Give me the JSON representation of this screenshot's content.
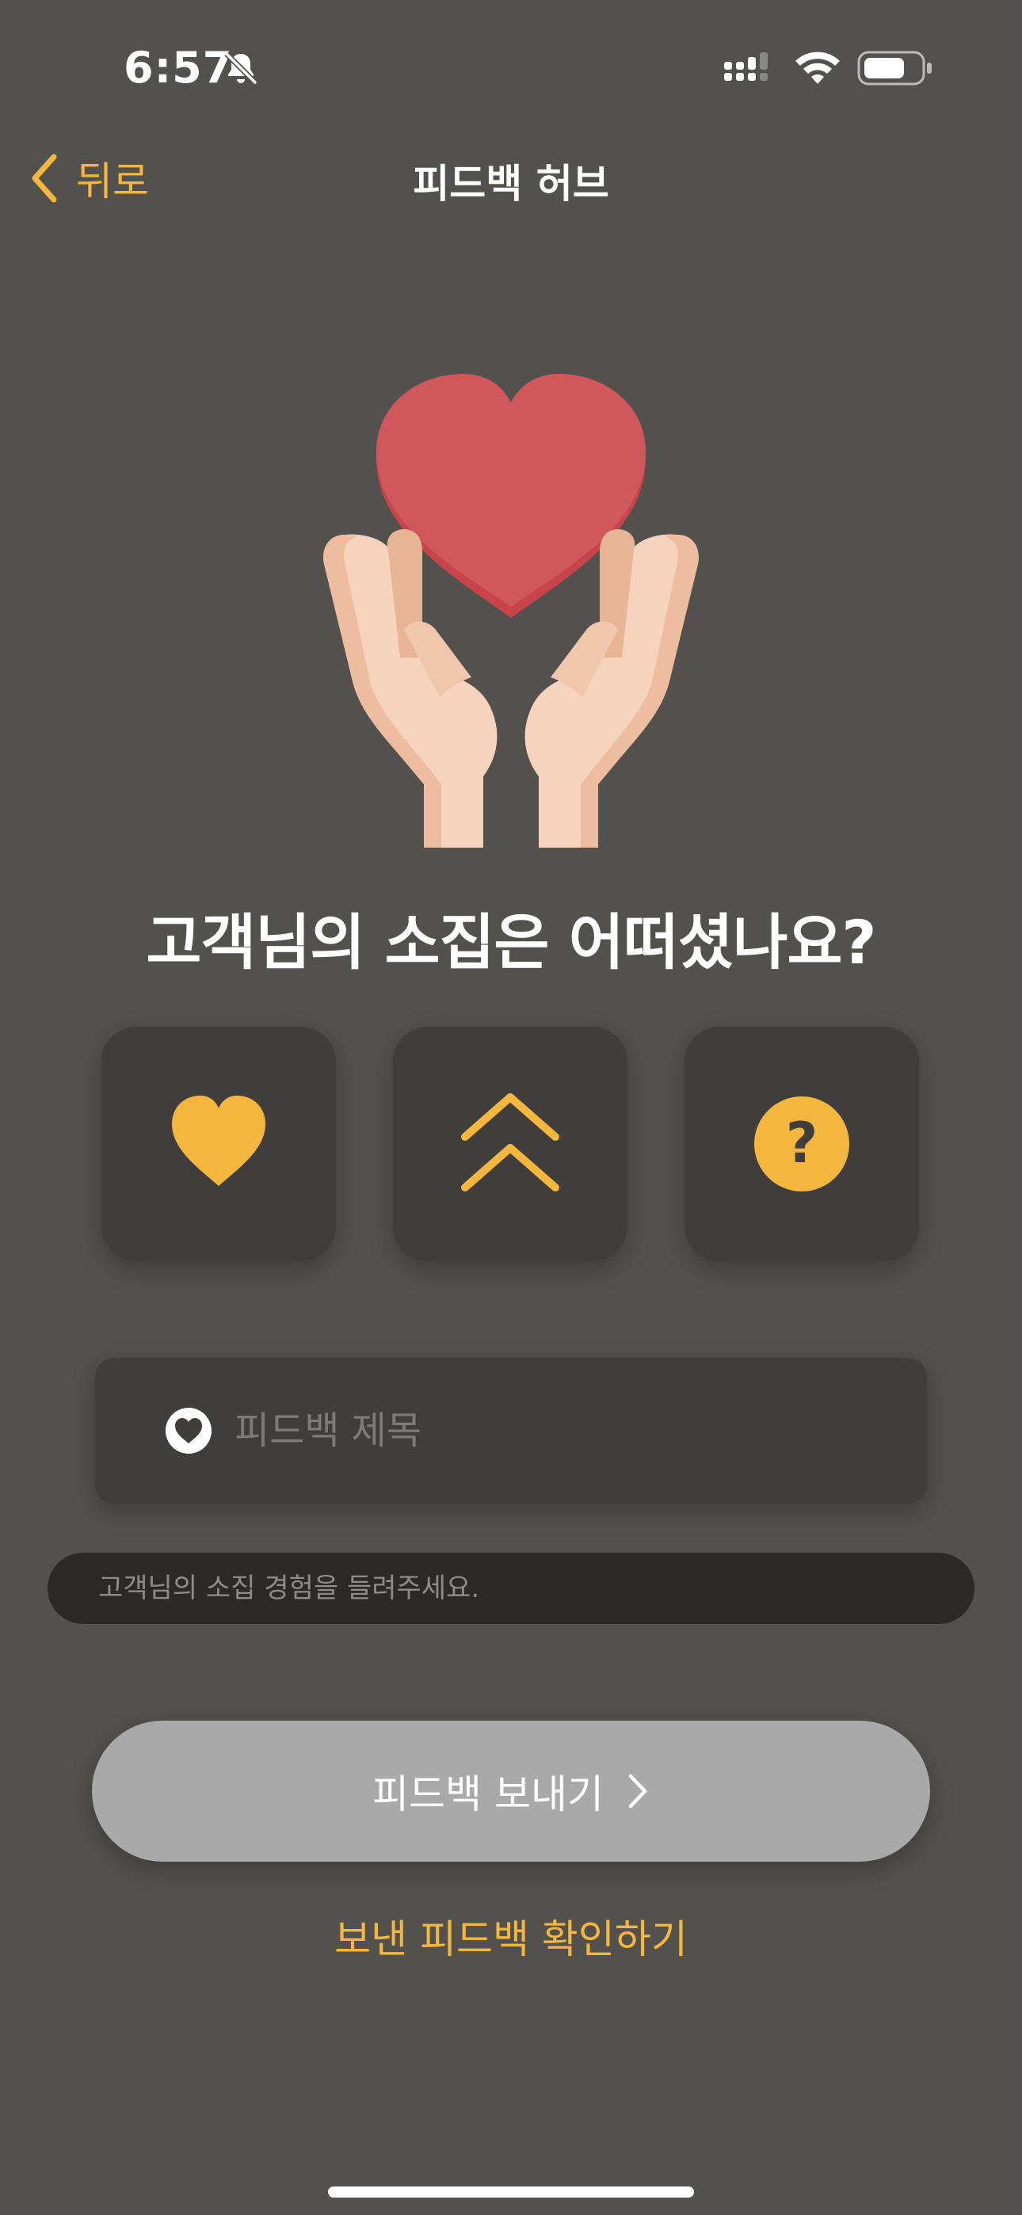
{
  "status_bar": {
    "time": "6:57"
  },
  "nav": {
    "back_label": "뒤로",
    "title": "피드백 허브"
  },
  "colors": {
    "accent": "#f4b63d",
    "background": "#53514e",
    "card": "#3f3e3c",
    "heart_red": "#d0575b"
  },
  "hero": {
    "icon": "heart-in-hands-illustration"
  },
  "question": "고객님의 소집은 어떠셨나요?",
  "choices": [
    {
      "icon": "heart-icon"
    },
    {
      "icon": "double-chevron-up-icon"
    },
    {
      "icon": "question-circle-icon"
    }
  ],
  "form": {
    "title_placeholder": "피드백 제목",
    "body_placeholder": "고객님의 소집 경험을 들려주세요."
  },
  "submit": {
    "label": "피드백 보내기"
  },
  "history_link": "보낸 피드백 확인하기"
}
